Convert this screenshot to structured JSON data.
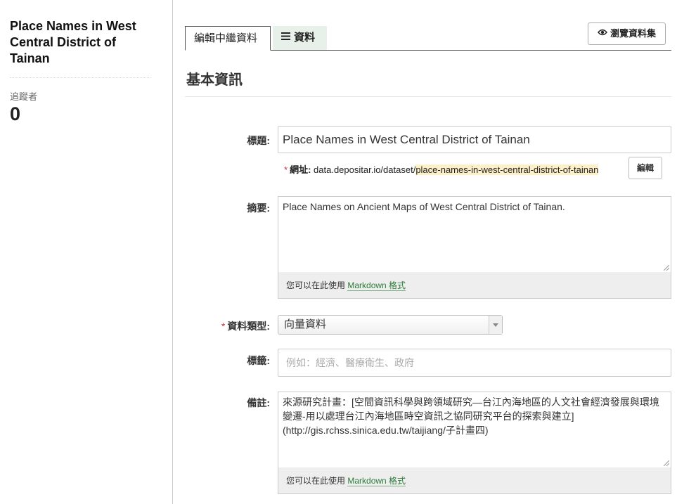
{
  "sidebar": {
    "title": "Place Names in West Central District of Tainan",
    "followers_label": "追蹤者",
    "followers_count": "0"
  },
  "tabs": {
    "edit_label": "編輯中繼資料",
    "resources_label": "資料"
  },
  "view_dataset_button": "瀏覽資料集",
  "section": {
    "title": "基本資訊"
  },
  "form": {
    "title": {
      "label": "標題:",
      "value": "Place Names in West Central District of Tainan"
    },
    "url": {
      "required_mark": "*",
      "label": "網址:",
      "prefix": "data.depositar.io/dataset/",
      "slug": "place-names-in-west-central-district-of-tainan",
      "edit_button": "編輯"
    },
    "summary": {
      "label": "摘要:",
      "value": "Place Names on Ancient Maps of West Central District of Tainan.",
      "markdown_hint": "您可以在此使用",
      "markdown_link": "Markdown 格式"
    },
    "data_type": {
      "required_mark": "*",
      "label": "資料類型:",
      "value": "向量資料"
    },
    "tags": {
      "label": "標籤:",
      "placeholder": "例如：經濟、醫療衛生、政府"
    },
    "notes": {
      "label": "備註:",
      "value": "來源研究計畫：[空間資訊科學與跨領域研究—台江內海地區的人文社會經濟發展與環境變遷-用以處理台江內海地區時空資訊之協同研究平台的探索與建立] (http://gis.rchss.sinica.edu.tw/taijiang/子計畫四)",
      "markdown_hint": "您可以在此使用",
      "markdown_link": "Markdown 格式"
    }
  }
}
